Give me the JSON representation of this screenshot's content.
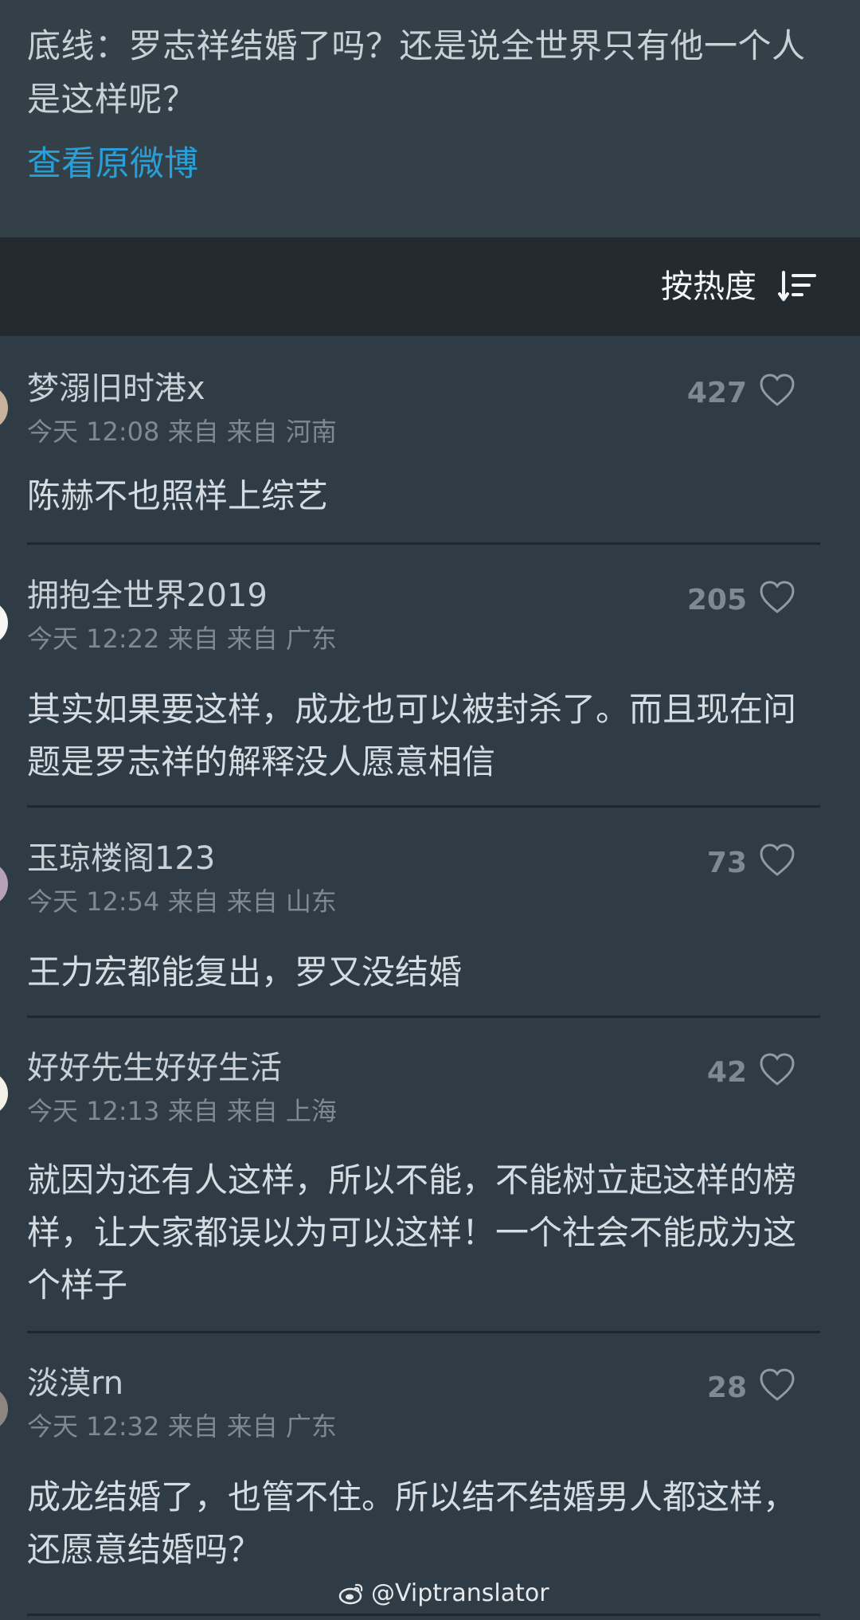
{
  "quote": {
    "text": "底线：罗志祥结婚了吗？还是说全世界只有他一个人是这样呢？",
    "view_original": "查看原微博"
  },
  "sort": {
    "label": "按热度",
    "icon": "sort-icon"
  },
  "comments": [
    {
      "name": "梦溺旧时港x",
      "meta": "今天 12:08 来自 来自 河南",
      "likes": "427",
      "text": "陈赫不也照样上综艺"
    },
    {
      "name": "拥抱全世界2019",
      "meta": "今天 12:22 来自 来自 广东",
      "likes": "205",
      "text": "其实如果要这样，成龙也可以被封杀了。而且现在问题是罗志祥的解释没人愿意相信"
    },
    {
      "name": "玉琼楼阁123",
      "meta": "今天 12:54 来自 来自 山东",
      "likes": "73",
      "text": "王力宏都能复出，罗又没结婚"
    },
    {
      "name": "好好先生好好生活",
      "meta": "今天 12:13 来自 来自 上海",
      "likes": "42",
      "text": "就因为还有人这样，所以不能，不能树立起这样的榜样，让大家都误以为可以这样！一个社会不能成为这个样子"
    },
    {
      "name": "淡漠rn",
      "meta": "今天 12:32 来自 来自 广东",
      "likes": "28",
      "text": "成龙结婚了，也管不住。所以结不结婚男人都这样，还愿意结婚吗？"
    }
  ],
  "watermark": {
    "text": "@Viptranslator",
    "icon": "weibo-icon"
  },
  "colors": {
    "background": "#303c45",
    "header_background": "#334048",
    "sort_bar_background": "#232b31",
    "link": "#2a9ed6"
  }
}
